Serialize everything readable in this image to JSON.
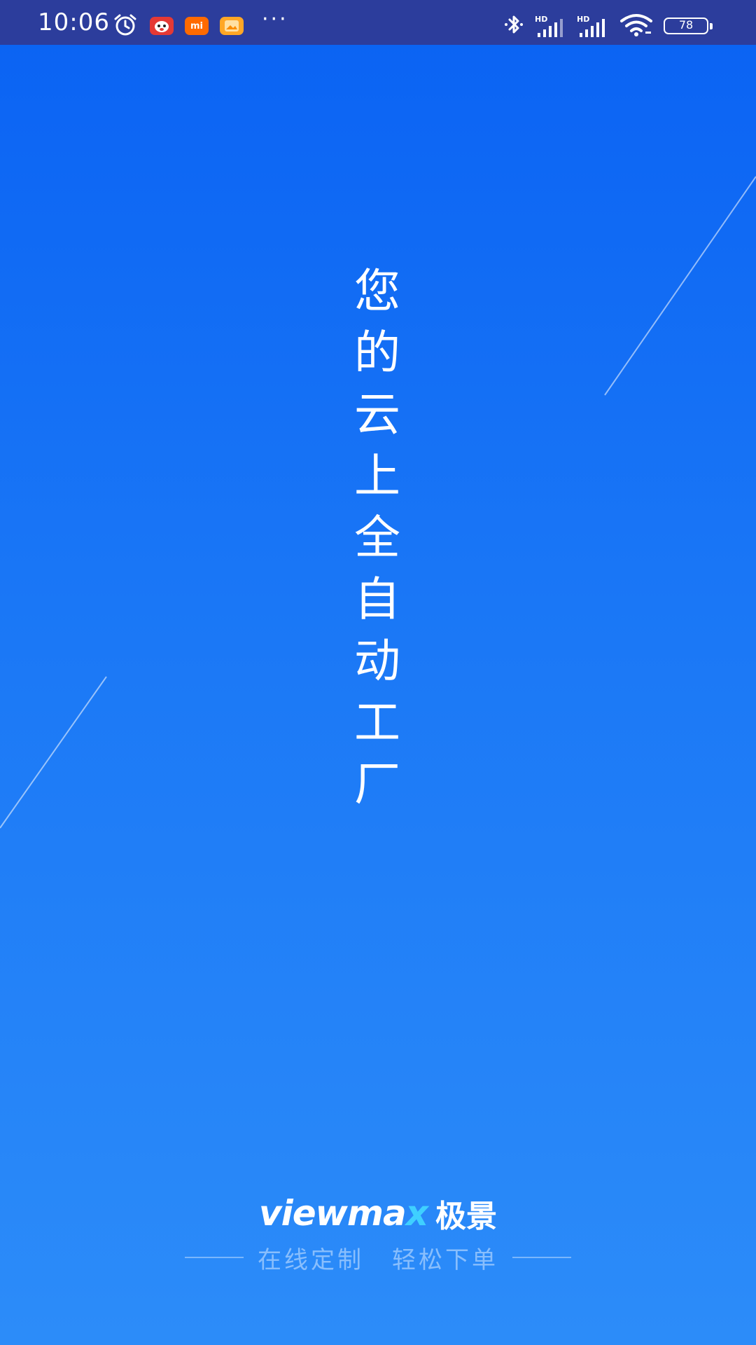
{
  "status_bar": {
    "time": "10:06",
    "battery_level": "78",
    "icons": [
      "alarm-icon",
      "app-red-mascot-icon",
      "xiaomi-mi-icon",
      "gallery-app-icon",
      "more-dots-icon",
      "bluetooth-icon",
      "signal-hd-1-icon",
      "signal-hd-2-icon",
      "wifi-icon",
      "battery-icon"
    ],
    "bar_color": "#2C3D9C",
    "mi_label": "mi",
    "more": "···",
    "hd_label": "HD"
  },
  "splash": {
    "slogan_chars": [
      "您",
      "的",
      "云",
      "上",
      "全",
      "自",
      "动",
      "工",
      "厂"
    ],
    "background_top": "#0A62F3",
    "background_bottom": "#2C8CF9"
  },
  "brand": {
    "latin_main": "viewma",
    "latin_x": "x",
    "chinese": "极景",
    "accent": "#3FD0FF"
  },
  "tagline": {
    "left": "在线定制",
    "right": "轻松下单"
  }
}
